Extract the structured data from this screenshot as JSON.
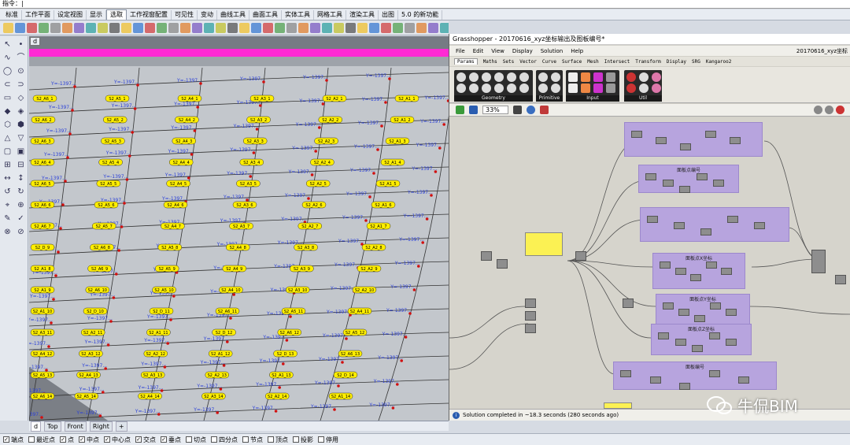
{
  "command": {
    "prompt": "指令：|"
  },
  "menu_tabs": [
    "标准",
    "工作平面",
    "设定视图",
    "显示",
    "选取",
    "工作视窗配置",
    "可见性",
    "变动",
    "曲线工具",
    "曲面工具",
    "实体工具",
    "网格工具",
    "渲染工具",
    "出图",
    "5.0 的新功能"
  ],
  "active_menu_index": 4,
  "viewport": {
    "name": "d",
    "tabs": [
      "d",
      "Top",
      "Front",
      "Right"
    ],
    "active_tab": 0
  },
  "label_sets": {
    "row_labels": [
      "S2_A6_1",
      "S2_A5_1",
      "S2_A4_1",
      "S2_A3_1",
      "S2_A2_1",
      "S2_A1_1",
      "S2_A6_2",
      "S2_A5_2",
      "S2_A4_2",
      "S2_A3_2",
      "S2_A2_2",
      "S2_A1_2",
      "S2_A6_3",
      "S2_A5_3",
      "S2_A4_3",
      "S2_A3_3",
      "S2_A2_3",
      "S2_A1_3",
      "S2_A6_4",
      "S2_A5_4",
      "S2_A4_4",
      "S2_A3_4",
      "S2_A2_4",
      "S2_A1_4",
      "S2_A6_5",
      "S2_A5_5",
      "S2_A4_5",
      "S2_A3_5",
      "S2_A2_5",
      "S2_A1_5",
      "S2_A6_6",
      "S2_A5_6",
      "S2_A4_6",
      "S2_A3_6",
      "S2_A2_6",
      "S2_A1_6",
      "S2_A6_7",
      "S2_A5_7",
      "S2_A4_7",
      "S2_A3_7",
      "S2_A2_7",
      "S2_A1_7",
      "S2_D_9",
      "S2_A6_8",
      "S2_A5_8",
      "S2_A4_8",
      "S2_A3_8",
      "S2_A2_8",
      "S2_A1_8",
      "S2_A6_9",
      "S2_A5_9",
      "S2_A4_9",
      "S2_A3_9",
      "S2_A2_9",
      "S2_A1_9",
      "S2_A6_10",
      "S2_A5_10",
      "S2_A4_10",
      "S2_A3_10",
      "S2_A2_10",
      "S2_A1_10",
      "S2_D_10",
      "S2_D_11",
      "S2_A6_11",
      "S2_A5_11",
      "S2_A4_11",
      "S2_A3_11",
      "S2_A2_11",
      "S2_A1_11",
      "S2_D_12",
      "S2_A6_12",
      "S2_A5_12",
      "S2_A4_12",
      "S2_A3_12",
      "S2_A2_12",
      "S2_A1_12",
      "S2_D_13",
      "S2_A6_13",
      "S2_A5_13",
      "S2_A4_13",
      "S2_A3_13",
      "S2_A2_13",
      "S2_A1_13",
      "S2_D_14",
      "S2_A6_14",
      "S2_A5_14",
      "S2_A4_14",
      "S2_A3_14",
      "S2_A2_14",
      "S2_A1_14",
      "S2_A6_15",
      "S2_A5_15",
      "S2_A4_15",
      "S2_A3_15",
      "S2_A2_15",
      "S2_A1_15",
      "S3_B1_10",
      "S2_C_10",
      "S2_C_11"
    ],
    "coord_prefix": "Y=-1397..."
  },
  "status": {
    "snaps": [
      {
        "label": "端点",
        "checked": true
      },
      {
        "label": "最近点",
        "checked": false
      },
      {
        "label": "点",
        "checked": true
      },
      {
        "label": "中点",
        "checked": true
      },
      {
        "label": "中心点",
        "checked": true
      },
      {
        "label": "交点",
        "checked": true
      },
      {
        "label": "垂点",
        "checked": true
      },
      {
        "label": "切点",
        "checked": false
      },
      {
        "label": "四分点",
        "checked": false
      },
      {
        "label": "节点",
        "checked": false
      },
      {
        "label": "顶点",
        "checked": false
      },
      {
        "label": "投影",
        "checked": false
      },
      {
        "label": "停用",
        "checked": false
      }
    ]
  },
  "grasshopper": {
    "title": "Grasshopper - 20170616_xyz坐标输出及图板编号*",
    "menu": [
      "File",
      "Edit",
      "View",
      "Display",
      "Solution",
      "Help"
    ],
    "doc_name": "20170616_xyz坐标",
    "tabs": [
      "Params",
      "Maths",
      "Sets",
      "Vector",
      "Curve",
      "Surface",
      "Mesh",
      "Intersect",
      "Transform",
      "Display",
      "SRG",
      "Kangaroo2"
    ],
    "active_tab": 0,
    "ribbon_groups": [
      "Geometry",
      "Primitive",
      "Input",
      "Util"
    ],
    "zoom": "33%",
    "groups": [
      "面板点编号",
      "面板点X坐标",
      "面板点Y坐标",
      "面板点Z坐标",
      "面板编号"
    ],
    "status_text": "Solution completed in ~18.3 seconds (280 seconds ago)"
  },
  "watermark": {
    "text": "牛侃BIM"
  },
  "colors": {
    "accent_magenta": "#ff2ad4",
    "label_yellow": "#ffee00",
    "gh_group": "#b7a4de",
    "gh_panel": "#fbf153"
  }
}
